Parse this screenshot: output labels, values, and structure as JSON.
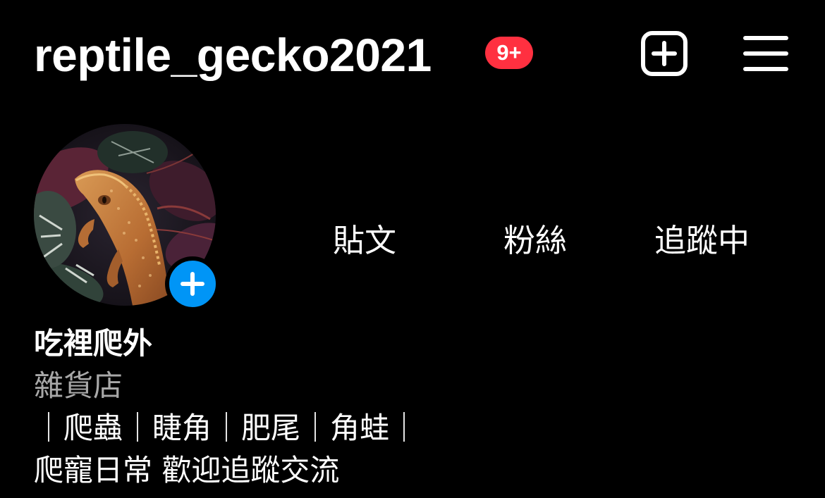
{
  "header": {
    "username": "reptile_gecko2021",
    "notification_badge": "9+",
    "new_post_icon": "plus-square-icon",
    "menu_icon": "hamburger-menu-icon"
  },
  "profile": {
    "avatar_description": "crested-gecko-photo",
    "story_add_icon": "plus-icon",
    "stats": {
      "posts_label": "貼文",
      "followers_label": "粉絲",
      "following_label": "追蹤中"
    },
    "display_name": "吃裡爬外",
    "category": "雜貨店",
    "bio_lines": [
      "｜爬蟲｜睫角｜肥尾｜角蛙｜",
      "爬寵日常 歡迎追蹤交流"
    ]
  },
  "colors": {
    "background": "#000000",
    "text": "#ffffff",
    "badge": "#ff3040",
    "story_add": "#0095f6",
    "category_text": "#a8a8a8"
  }
}
